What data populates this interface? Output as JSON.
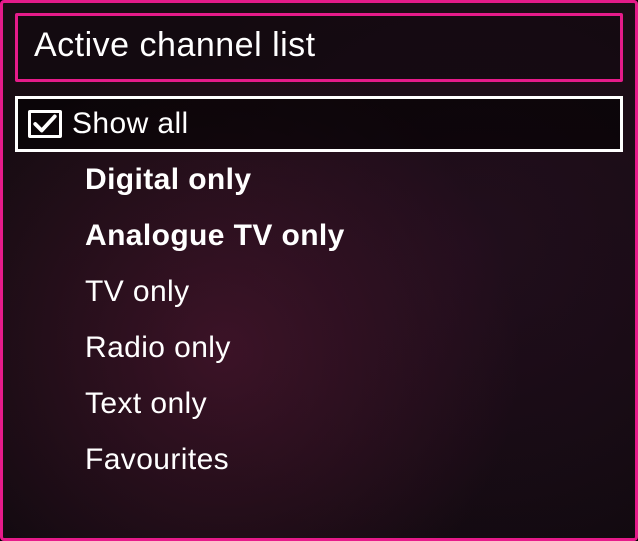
{
  "title": "Active channel list",
  "options": [
    {
      "label": "Show all",
      "checked": true,
      "selected": true
    },
    {
      "label": "Digital only",
      "checked": false,
      "selected": false
    },
    {
      "label": "Analogue TV only",
      "checked": false,
      "selected": false
    },
    {
      "label": "TV only",
      "checked": false,
      "selected": false
    },
    {
      "label": "Radio only",
      "checked": false,
      "selected": false
    },
    {
      "label": "Text only",
      "checked": false,
      "selected": false
    },
    {
      "label": "Favourites",
      "checked": false,
      "selected": false
    }
  ]
}
